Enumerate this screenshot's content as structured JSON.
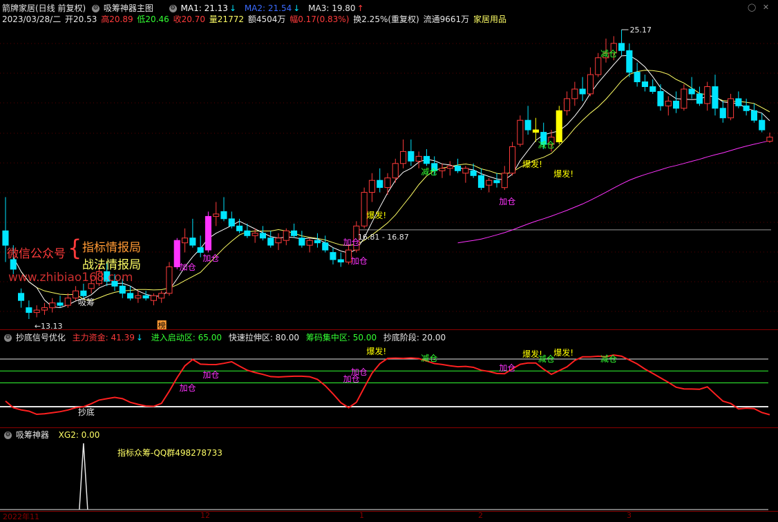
{
  "header": {
    "stock_title": "箭牌家居(日线 前复权)",
    "indicator_name": "吸筹神器主图",
    "ma1_label": "MA1: 21.13",
    "ma1_arrow": "↓",
    "ma2_label": "MA2: 21.54",
    "ma2_arrow": "↓",
    "ma3_label": "MA3: 19.80",
    "ma3_arrow": "↑",
    "date": "2023/03/28/二",
    "open": "开20.53",
    "high": "高20.89",
    "low": "低20.46",
    "close": "收20.70",
    "volume": "量21772",
    "amount": "额4504万",
    "change": "幅0.17(0.83%)",
    "turnover": "换2.25%(重复权)",
    "float": "流通9661万",
    "industry": "家居用品"
  },
  "colors": {
    "up": "#ff3b3b",
    "down": "#00e5ff",
    "ma1": "#ffffff",
    "ma2": "#ffff66",
    "ma3": "#ff33ff",
    "boom": "#ffff00",
    "jiacang": "#ff33ff",
    "jiancang": "#33ff33",
    "axis_red": "#8b0000"
  },
  "main_chart": {
    "high_price_label": "25.17",
    "low_price_label": "13.13",
    "ref_line_label": "16.81 - 16.87",
    "watermark_1": "微信公众号",
    "watermark_brace": "{",
    "watermark_2": "指标情报局",
    "watermark_3": "战法情报局",
    "watermark_url": "www.zhibiao168.com",
    "bang_marker": "榜",
    "annotations": [
      {
        "text": "吸筹",
        "type": "white"
      },
      {
        "text": "加仓",
        "type": "jiacang"
      },
      {
        "text": "加仓",
        "type": "jiacang"
      },
      {
        "text": "加仓",
        "type": "jiacang"
      },
      {
        "text": "加仓",
        "type": "jiacang"
      },
      {
        "text": "爆发!",
        "type": "boom"
      },
      {
        "text": "减仓",
        "type": "jiancang"
      },
      {
        "text": "加仓",
        "type": "jiacang"
      },
      {
        "text": "爆发!",
        "type": "boom"
      },
      {
        "text": "减仓",
        "type": "jiancang"
      },
      {
        "text": "爆发!",
        "type": "boom"
      },
      {
        "text": "减仓",
        "type": "jiancang"
      }
    ]
  },
  "panel2": {
    "title": "抄底信号优化",
    "main_fund": "主力资金: 41.39",
    "main_fund_arrow": "↓",
    "enter_zone": "进入启动区: 65.00",
    "fast_zone": "快速拉伸区: 80.00",
    "chip_zone": "筹码集中区: 50.00",
    "bottom_stage": "抄底阶段: 20.00",
    "annotations": [
      {
        "text": "抄底",
        "type": "white"
      },
      {
        "text": "加仓",
        "type": "jiacang"
      },
      {
        "text": "加仓",
        "type": "jiacang"
      },
      {
        "text": "加仓",
        "type": "jiacang"
      },
      {
        "text": "加仓",
        "type": "jiacang"
      },
      {
        "text": "爆发!",
        "type": "boom"
      },
      {
        "text": "减仓",
        "type": "jiancang"
      },
      {
        "text": "加仓",
        "type": "jiacang"
      },
      {
        "text": "爆发!",
        "type": "boom"
      },
      {
        "text": "减仓",
        "type": "jiancang"
      },
      {
        "text": "爆发!",
        "type": "boom"
      },
      {
        "text": "减仓",
        "type": "jiancang"
      }
    ]
  },
  "panel3": {
    "title": "吸筹神器",
    "xg2": "XG2: 0.00",
    "note": "指标众筹-QQ群498278733"
  },
  "x_axis": {
    "labels": [
      "2022年11",
      "12",
      "1",
      "2",
      "3"
    ]
  },
  "chart_data": {
    "type": "candlestick",
    "price_range": [
      13.13,
      25.17
    ],
    "ref_line_price": 16.84,
    "osc_levels": [
      80,
      65,
      50,
      20
    ],
    "candles": [
      {
        "o": 16.8,
        "h": 18.2,
        "l": 15.5,
        "c": 16.2
      },
      {
        "o": 15.6,
        "h": 16.2,
        "l": 15.0,
        "c": 15.2
      },
      {
        "o": 14.2,
        "h": 14.4,
        "l": 13.6,
        "c": 13.9
      },
      {
        "o": 13.6,
        "h": 13.9,
        "l": 13.13,
        "c": 13.4
      },
      {
        "o": 13.4,
        "h": 13.7,
        "l": 13.2,
        "c": 13.5
      },
      {
        "o": 13.5,
        "h": 13.8,
        "l": 13.3,
        "c": 13.6
      },
      {
        "o": 13.6,
        "h": 14.0,
        "l": 13.4,
        "c": 13.8
      },
      {
        "o": 13.8,
        "h": 14.1,
        "l": 13.6,
        "c": 13.7
      },
      {
        "o": 13.7,
        "h": 14.2,
        "l": 13.6,
        "c": 14.0
      },
      {
        "o": 14.0,
        "h": 14.5,
        "l": 13.9,
        "c": 14.3
      },
      {
        "o": 14.3,
        "h": 14.6,
        "l": 14.0,
        "c": 14.1
      },
      {
        "o": 14.4,
        "h": 14.8,
        "l": 14.2,
        "c": 14.6
      },
      {
        "o": 14.6,
        "h": 15.4,
        "l": 14.5,
        "c": 15.1
      },
      {
        "o": 15.1,
        "h": 15.5,
        "l": 14.5,
        "c": 14.7
      },
      {
        "o": 14.7,
        "h": 15.0,
        "l": 14.3,
        "c": 14.5
      },
      {
        "o": 14.5,
        "h": 14.8,
        "l": 14.0,
        "c": 14.2
      },
      {
        "o": 14.2,
        "h": 14.5,
        "l": 13.9,
        "c": 14.0
      },
      {
        "o": 14.0,
        "h": 14.3,
        "l": 13.8,
        "c": 14.1
      },
      {
        "o": 14.1,
        "h": 14.3,
        "l": 13.9,
        "c": 14.0
      },
      {
        "o": 13.9,
        "h": 14.2,
        "l": 13.7,
        "c": 14.1
      },
      {
        "o": 14.0,
        "h": 14.3,
        "l": 13.8,
        "c": 14.2
      },
      {
        "o": 14.2,
        "h": 15.5,
        "l": 14.1,
        "c": 15.3
      },
      {
        "o": 15.3,
        "h": 16.5,
        "l": 15.2,
        "c": 16.4
      },
      {
        "o": 16.3,
        "h": 16.9,
        "l": 15.9,
        "c": 16.5
      },
      {
        "o": 16.5,
        "h": 17.3,
        "l": 16.1,
        "c": 16.2
      },
      {
        "o": 16.1,
        "h": 16.6,
        "l": 15.7,
        "c": 15.9
      },
      {
        "o": 16.0,
        "h": 17.6,
        "l": 15.9,
        "c": 17.4
      },
      {
        "o": 17.4,
        "h": 18.0,
        "l": 17.0,
        "c": 17.5
      },
      {
        "o": 17.6,
        "h": 18.2,
        "l": 17.2,
        "c": 17.3
      },
      {
        "o": 17.3,
        "h": 17.6,
        "l": 16.9,
        "c": 17.0
      },
      {
        "o": 17.0,
        "h": 17.3,
        "l": 16.7,
        "c": 16.8
      },
      {
        "o": 16.8,
        "h": 17.1,
        "l": 16.5,
        "c": 16.6
      },
      {
        "o": 16.6,
        "h": 16.9,
        "l": 16.3,
        "c": 16.7
      },
      {
        "o": 16.7,
        "h": 17.0,
        "l": 16.4,
        "c": 16.5
      },
      {
        "o": 16.5,
        "h": 16.8,
        "l": 16.1,
        "c": 16.2
      },
      {
        "o": 16.3,
        "h": 16.7,
        "l": 16.0,
        "c": 16.5
      },
      {
        "o": 16.4,
        "h": 16.9,
        "l": 16.2,
        "c": 16.8
      },
      {
        "o": 16.8,
        "h": 17.1,
        "l": 16.5,
        "c": 16.6
      },
      {
        "o": 16.5,
        "h": 16.8,
        "l": 16.1,
        "c": 16.2
      },
      {
        "o": 16.2,
        "h": 16.5,
        "l": 15.9,
        "c": 16.4
      },
      {
        "o": 16.4,
        "h": 16.7,
        "l": 16.1,
        "c": 16.3
      },
      {
        "o": 16.3,
        "h": 16.6,
        "l": 15.9,
        "c": 16.0
      },
      {
        "o": 15.9,
        "h": 16.1,
        "l": 15.4,
        "c": 15.6
      },
      {
        "o": 15.6,
        "h": 15.9,
        "l": 15.3,
        "c": 15.5
      },
      {
        "o": 15.5,
        "h": 16.2,
        "l": 15.4,
        "c": 16.0
      },
      {
        "o": 16.0,
        "h": 17.2,
        "l": 15.9,
        "c": 17.0
      },
      {
        "o": 17.0,
        "h": 18.6,
        "l": 16.9,
        "c": 18.4
      },
      {
        "o": 18.4,
        "h": 19.2,
        "l": 18.0,
        "c": 18.9
      },
      {
        "o": 18.9,
        "h": 19.4,
        "l": 18.4,
        "c": 18.6
      },
      {
        "o": 18.6,
        "h": 19.2,
        "l": 18.3,
        "c": 19.0
      },
      {
        "o": 19.0,
        "h": 19.8,
        "l": 18.8,
        "c": 19.6
      },
      {
        "o": 19.6,
        "h": 20.6,
        "l": 19.4,
        "c": 20.1
      },
      {
        "o": 20.1,
        "h": 20.6,
        "l": 19.5,
        "c": 19.7
      },
      {
        "o": 19.7,
        "h": 20.1,
        "l": 19.4,
        "c": 19.9
      },
      {
        "o": 19.9,
        "h": 20.2,
        "l": 19.5,
        "c": 19.6
      },
      {
        "o": 19.6,
        "h": 19.9,
        "l": 19.1,
        "c": 19.3
      },
      {
        "o": 19.3,
        "h": 19.6,
        "l": 19.0,
        "c": 19.4
      },
      {
        "o": 19.4,
        "h": 19.7,
        "l": 19.1,
        "c": 19.5
      },
      {
        "o": 19.5,
        "h": 19.8,
        "l": 19.2,
        "c": 19.3
      },
      {
        "o": 19.2,
        "h": 19.5,
        "l": 18.8,
        "c": 19.4
      },
      {
        "o": 19.3,
        "h": 19.6,
        "l": 19.0,
        "c": 19.1
      },
      {
        "o": 19.1,
        "h": 19.4,
        "l": 18.5,
        "c": 18.6
      },
      {
        "o": 18.7,
        "h": 19.0,
        "l": 18.4,
        "c": 18.9
      },
      {
        "o": 18.9,
        "h": 19.2,
        "l": 18.6,
        "c": 18.8
      },
      {
        "o": 18.6,
        "h": 19.5,
        "l": 18.5,
        "c": 19.2
      },
      {
        "o": 19.2,
        "h": 20.5,
        "l": 19.1,
        "c": 20.3
      },
      {
        "o": 20.4,
        "h": 21.6,
        "l": 20.3,
        "c": 21.4
      },
      {
        "o": 21.4,
        "h": 22.0,
        "l": 20.8,
        "c": 21.0
      },
      {
        "o": 21.0,
        "h": 21.5,
        "l": 20.5,
        "c": 20.9
      },
      {
        "o": 20.9,
        "h": 21.3,
        "l": 20.2,
        "c": 20.4
      },
      {
        "o": 20.4,
        "h": 21.0,
        "l": 20.1,
        "c": 20.7
      },
      {
        "o": 20.5,
        "h": 22.0,
        "l": 20.4,
        "c": 21.8
      },
      {
        "o": 21.8,
        "h": 22.6,
        "l": 21.6,
        "c": 22.3
      },
      {
        "o": 22.3,
        "h": 23.0,
        "l": 22.0,
        "c": 22.7
      },
      {
        "o": 22.7,
        "h": 23.2,
        "l": 22.2,
        "c": 22.5
      },
      {
        "o": 22.5,
        "h": 23.6,
        "l": 22.4,
        "c": 23.3
      },
      {
        "o": 23.3,
        "h": 24.2,
        "l": 23.2,
        "c": 24.0
      },
      {
        "o": 24.0,
        "h": 24.8,
        "l": 23.8,
        "c": 24.2
      },
      {
        "o": 24.2,
        "h": 24.9,
        "l": 23.9,
        "c": 24.6
      },
      {
        "o": 24.6,
        "h": 25.17,
        "l": 24.1,
        "c": 24.3
      },
      {
        "o": 24.3,
        "h": 24.6,
        "l": 23.2,
        "c": 23.4
      },
      {
        "o": 23.4,
        "h": 23.8,
        "l": 22.8,
        "c": 23.0
      },
      {
        "o": 23.0,
        "h": 23.3,
        "l": 22.6,
        "c": 22.8
      },
      {
        "o": 22.8,
        "h": 23.1,
        "l": 22.5,
        "c": 22.6
      },
      {
        "o": 22.6,
        "h": 22.9,
        "l": 21.8,
        "c": 22.0
      },
      {
        "o": 22.0,
        "h": 22.4,
        "l": 21.6,
        "c": 22.2
      },
      {
        "o": 22.2,
        "h": 22.6,
        "l": 21.7,
        "c": 21.9
      },
      {
        "o": 21.9,
        "h": 22.9,
        "l": 21.8,
        "c": 22.7
      },
      {
        "o": 22.7,
        "h": 23.2,
        "l": 22.3,
        "c": 22.5
      },
      {
        "o": 22.5,
        "h": 22.8,
        "l": 22.0,
        "c": 22.1
      },
      {
        "o": 22.1,
        "h": 23.0,
        "l": 21.8,
        "c": 22.8
      },
      {
        "o": 22.8,
        "h": 23.3,
        "l": 21.6,
        "c": 21.9
      },
      {
        "o": 21.9,
        "h": 22.2,
        "l": 21.3,
        "c": 21.5
      },
      {
        "o": 21.5,
        "h": 22.5,
        "l": 21.4,
        "c": 22.3
      },
      {
        "o": 22.3,
        "h": 22.6,
        "l": 21.9,
        "c": 22.0
      },
      {
        "o": 22.0,
        "h": 22.3,
        "l": 21.6,
        "c": 21.8
      },
      {
        "o": 21.8,
        "h": 22.1,
        "l": 21.3,
        "c": 21.4
      },
      {
        "o": 21.4,
        "h": 21.7,
        "l": 20.9,
        "c": 21.0
      },
      {
        "o": 20.53,
        "h": 20.89,
        "l": 20.46,
        "c": 20.7
      }
    ]
  }
}
